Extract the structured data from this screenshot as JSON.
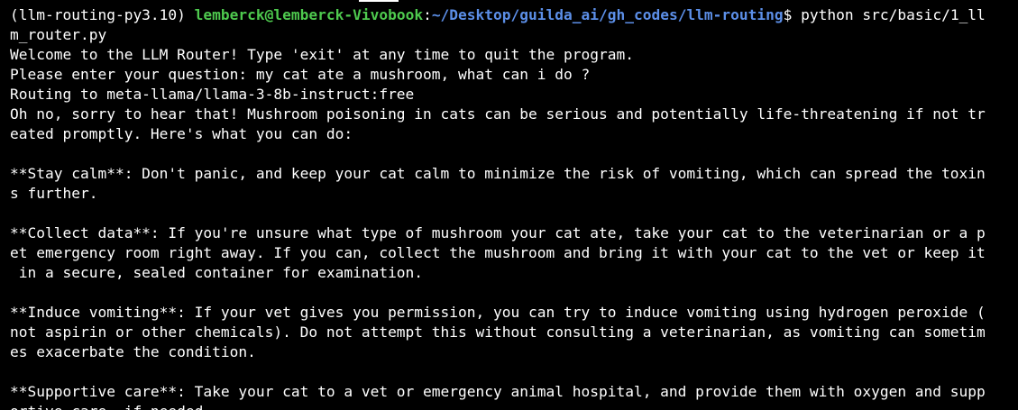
{
  "prompt": {
    "venv": "(llm-routing-py3.10) ",
    "user_host": "lemberck@lemberck-Vivobook",
    "separator": ":",
    "path": "~/Desktop/guilda_ai/gh_codes/llm-routing",
    "symbol": "$ ",
    "command": "python src/basic/1_ll",
    "command_cont": "m_router.py"
  },
  "output_lines": [
    "Welcome to the LLM Router! Type 'exit' at any time to quit the program.",
    "Please enter your question: my cat ate a mushroom, what can i do ?",
    "Routing to meta-llama/llama-3-8b-instruct:free",
    "Oh no, sorry to hear that! Mushroom poisoning in cats can be serious and potentially life-threatening if not tr",
    "eated promptly. Here's what you can do:",
    "",
    "**Stay calm**: Don't panic, and keep your cat calm to minimize the risk of vomiting, which can spread the toxin",
    "s further.",
    "",
    "**Collect data**: If you're unsure what type of mushroom your cat ate, take your cat to the veterinarian or a p",
    "et emergency room right away. If you can, collect the mushroom and bring it with your cat to the vet or keep it",
    " in a secure, sealed container for examination.",
    "",
    "**Induce vomiting**: If your vet gives you permission, you can try to induce vomiting using hydrogen peroxide (",
    "not aspirin or other chemicals). Do not attempt this without consulting a veterinarian, as vomiting can sometim",
    "es exacerbate the condition.",
    "",
    "**Supportive care**: Take your cat to a vet or emergency animal hospital, and provide them with oxygen and supp",
    "ortive care, if needed."
  ],
  "colors": {
    "background": "#000000",
    "text": "#ffffff",
    "user_host": "#4ec94e",
    "path": "#5c8fe8"
  }
}
